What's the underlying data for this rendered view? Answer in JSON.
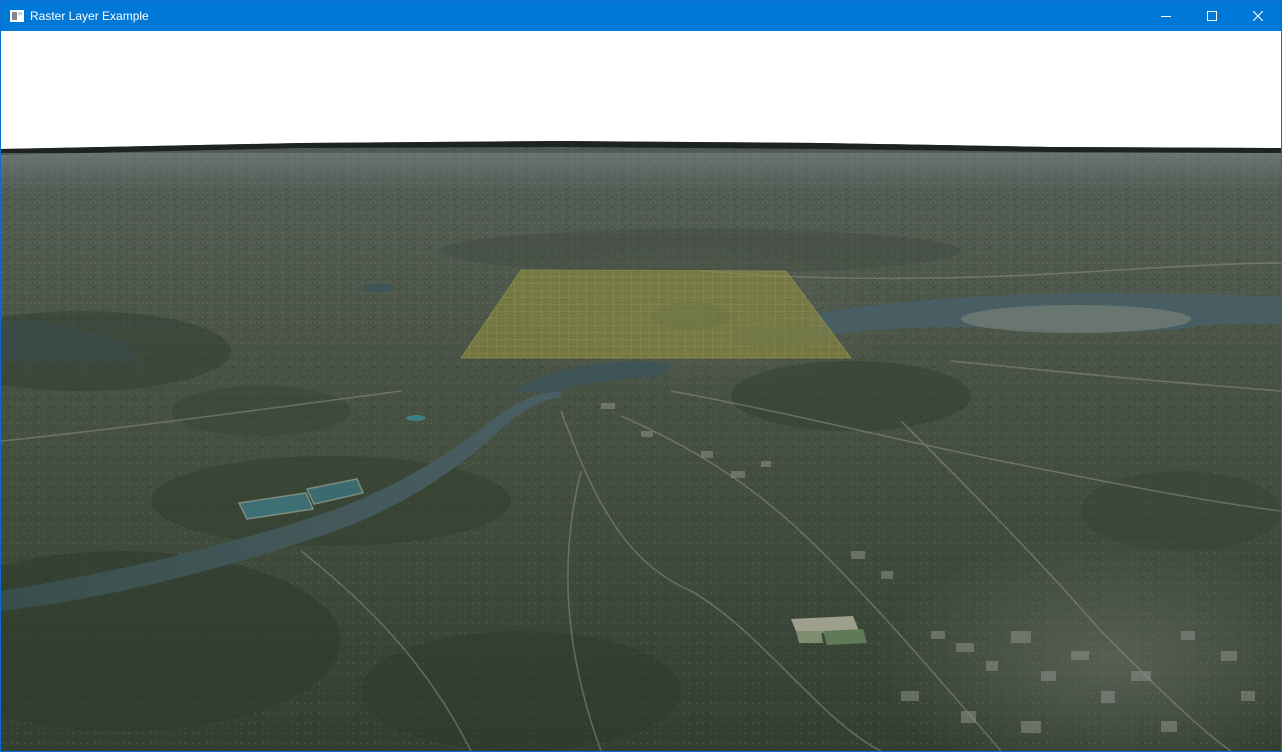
{
  "window": {
    "title": "Raster Layer Example",
    "app_icon": "window-app-icon",
    "controls": {
      "minimize_icon": "minimize-icon",
      "maximize_icon": "maximize-icon",
      "close_icon": "close-icon"
    },
    "accent_color": "#0078d7"
  },
  "scene": {
    "sky_color": "#ffffff",
    "terrain_color": "#3c4636",
    "raster_overlay_color": "#8b8a3a",
    "water_color": "#3f5556"
  }
}
